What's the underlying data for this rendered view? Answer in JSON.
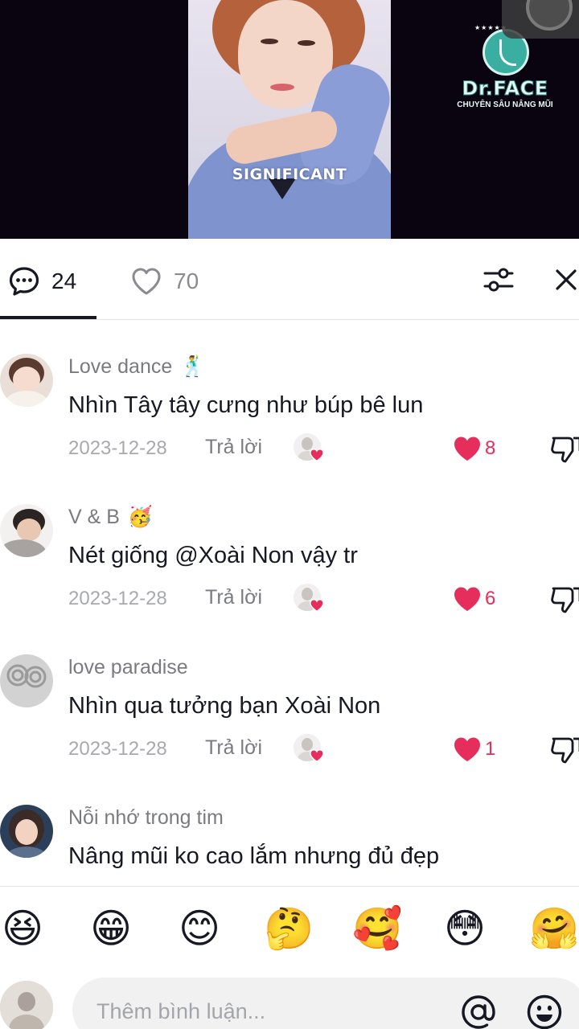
{
  "video": {
    "caption": "SIGNIFICANT",
    "logo_name": "Dr.FACE",
    "logo_tagline": "CHUYÊN SÂU NÂNG MŨI"
  },
  "stats": {
    "comments_count": "24",
    "likes_count": "70",
    "comment_icon": "comment-bubble-icon",
    "like_icon": "heart-outline-icon",
    "filter_icon": "sliders-icon",
    "close_icon": "close-icon"
  },
  "comments": [
    {
      "username": "Love dance",
      "username_emoji": "🕺",
      "text": "Nhìn Tây tây cưng như búp bê lun",
      "date": "2023-12-28",
      "reply_label": "Trả lời",
      "likes": "8"
    },
    {
      "username": "V & B",
      "username_emoji": "🥳",
      "text": "Nét giống @Xoài Non vậy tr",
      "date": "2023-12-28",
      "reply_label": "Trả lời",
      "likes": "6"
    },
    {
      "username": "love paradise",
      "username_emoji": "",
      "text": "Nhìn qua tưởng bạn Xoài Non",
      "date": "2023-12-28",
      "reply_label": "Trả lời",
      "likes": "1"
    },
    {
      "username": "Nỗi nhớ trong tim",
      "username_emoji": "",
      "text": "Nâng mũi ko cao lắm nhưng đủ đẹp",
      "date": "",
      "reply_label": "",
      "likes": ""
    }
  ],
  "quick_emojis": [
    "😆",
    "😁",
    "😊",
    "🤔",
    "🥰",
    "😳",
    "🤗"
  ],
  "input": {
    "placeholder": "Thêm bình luận...",
    "mention_icon": "at-sign-icon",
    "emoji_icon": "smiley-icon"
  },
  "colors": {
    "like_red": "#e62e5c",
    "text_dark": "#161823",
    "text_muted": "#7a7b80",
    "divider": "#e3e3e4"
  }
}
